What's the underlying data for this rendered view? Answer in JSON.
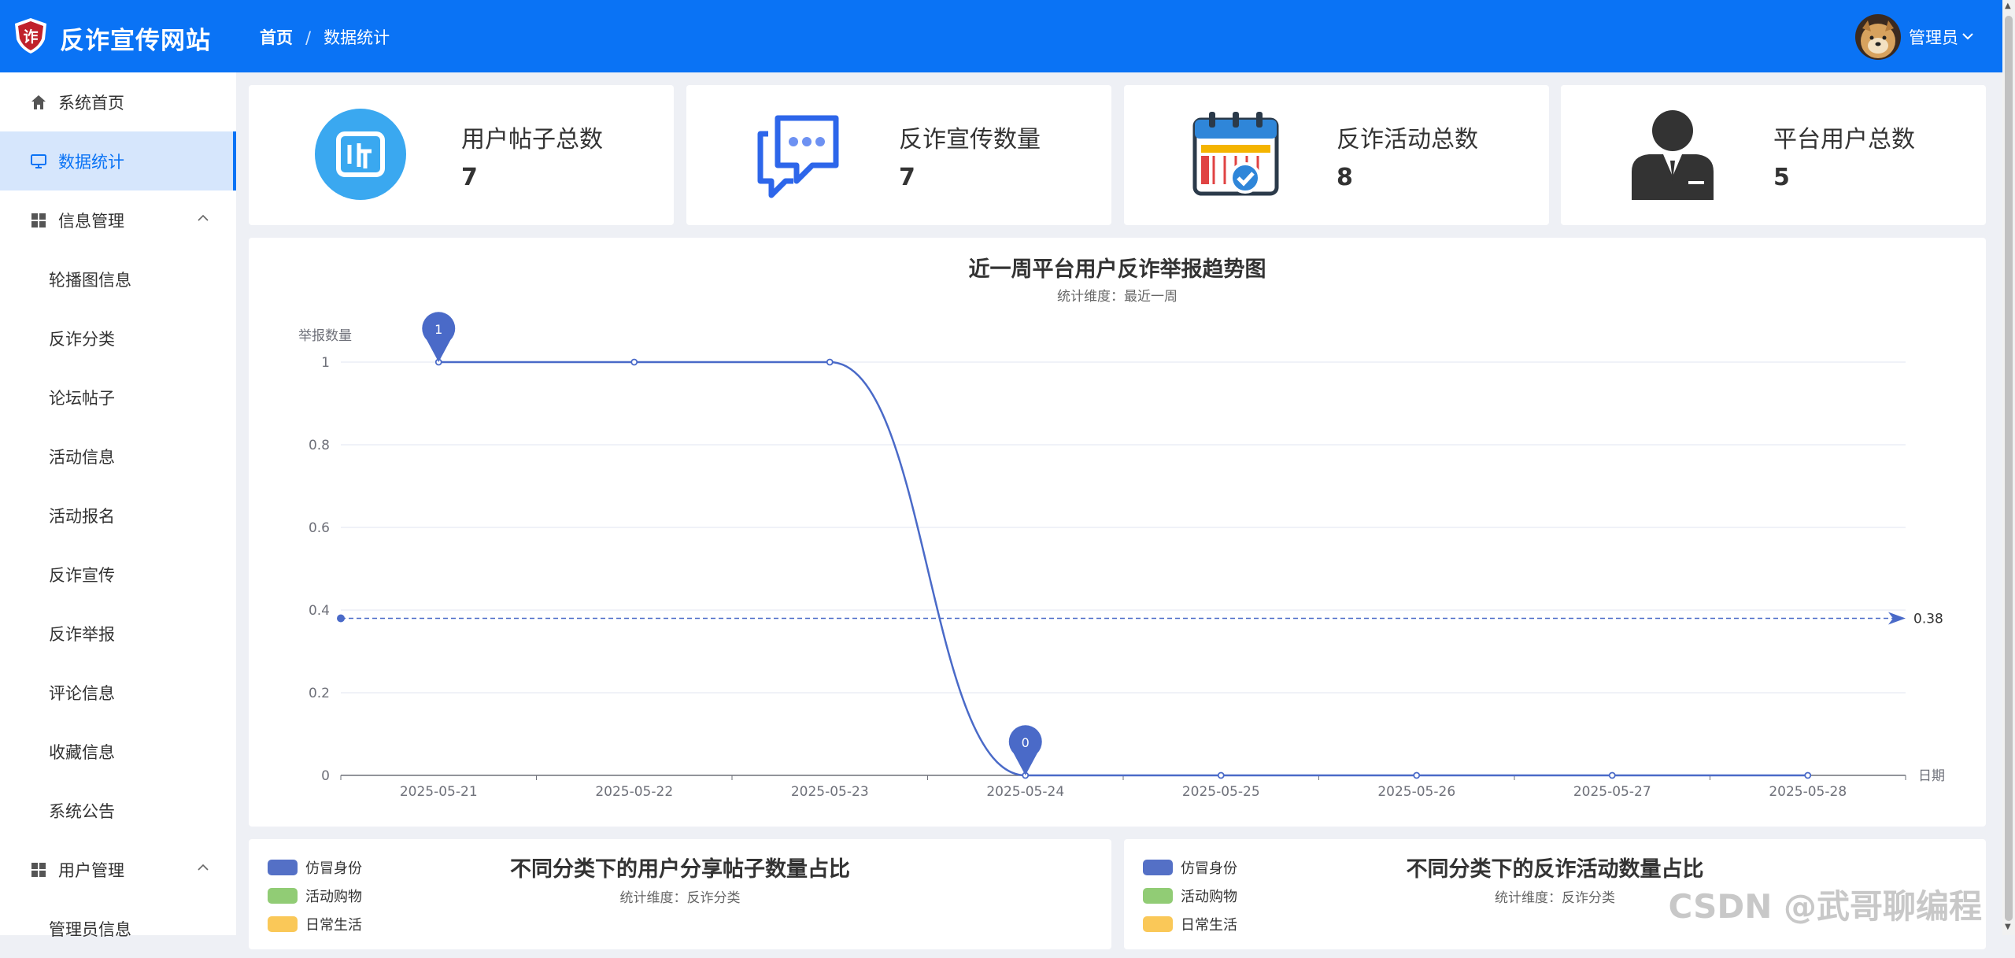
{
  "app": {
    "title": "反诈宣传网站",
    "logo_char": "诈"
  },
  "breadcrumb": {
    "home": "首页",
    "separator": "/",
    "current": "数据统计"
  },
  "user": {
    "name": "管理员"
  },
  "sidebar": {
    "items": [
      {
        "label": "系统首页",
        "icon": "home-icon"
      },
      {
        "label": "数据统计",
        "icon": "monitor-icon",
        "active": true
      },
      {
        "label": "信息管理",
        "icon": "grid-icon",
        "group": true
      },
      {
        "label": "轮播图信息"
      },
      {
        "label": "反诈分类"
      },
      {
        "label": "论坛帖子"
      },
      {
        "label": "活动信息"
      },
      {
        "label": "活动报名"
      },
      {
        "label": "反诈宣传"
      },
      {
        "label": "反诈举报"
      },
      {
        "label": "评论信息"
      },
      {
        "label": "收藏信息"
      },
      {
        "label": "系统公告"
      },
      {
        "label": "用户管理",
        "icon": "grid-icon",
        "group": true
      },
      {
        "label": "管理员信息"
      }
    ]
  },
  "stats": [
    {
      "label": "用户帖子总数",
      "value": "7",
      "icon": "post-icon",
      "color": "#3aa8f0"
    },
    {
      "label": "反诈宣传数量",
      "value": "7",
      "icon": "chat-icon",
      "color": "#2d66ea"
    },
    {
      "label": "反诈活动总数",
      "value": "8",
      "icon": "calendar-icon",
      "color": "#2f86d9"
    },
    {
      "label": "平台用户总数",
      "value": "5",
      "icon": "person-icon",
      "color": "#333333"
    }
  ],
  "chart_data": {
    "type": "line",
    "title": "近一周平台用户反诈举报趋势图",
    "subtitle": "统计维度：最近一周",
    "ylabel": "举报数量",
    "xlabel": "日期",
    "categories": [
      "2025-05-21",
      "2025-05-22",
      "2025-05-23",
      "2025-05-24",
      "2025-05-25",
      "2025-05-26",
      "2025-05-27",
      "2025-05-28"
    ],
    "series": [
      {
        "values": [
          1,
          1,
          1,
          0,
          0,
          0,
          0,
          0
        ]
      }
    ],
    "ylim": [
      0,
      1
    ],
    "yticks": [
      "0",
      "0.2",
      "0.4",
      "0.6",
      "0.8",
      "1"
    ],
    "mark_points": [
      {
        "category": "2025-05-21",
        "value": 1,
        "label": "1"
      },
      {
        "category": "2025-05-24",
        "value": 0,
        "label": "0"
      }
    ],
    "mark_line": {
      "value": 0.38,
      "label": "0.38"
    },
    "grid": true,
    "color": "#4a6ac8"
  },
  "pie_panels": [
    {
      "title": "不同分类下的用户分享帖子数量占比",
      "subtitle": "统计维度：反诈分类"
    },
    {
      "title": "不同分类下的反诈活动数量占比",
      "subtitle": "统计维度：反诈分类"
    }
  ],
  "pie_legend": [
    {
      "label": "仿冒身份",
      "color": "#5470c6"
    },
    {
      "label": "活动购物",
      "color": "#91cc75"
    },
    {
      "label": "日常生活",
      "color": "#fac858"
    }
  ],
  "watermark": "CSDN @武哥聊编程"
}
